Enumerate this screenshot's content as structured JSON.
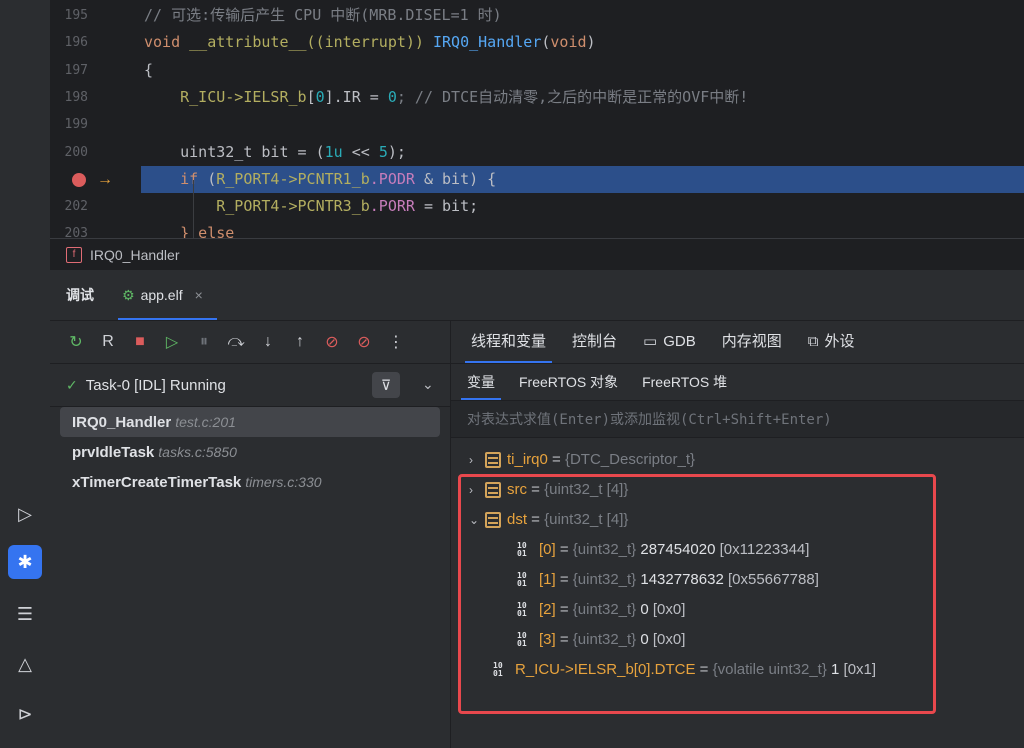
{
  "editor": {
    "lines": [
      {
        "num": "195",
        "parts": [
          {
            "t": "// 可选:传输后产生 CPU 中断(MRB.DISEL=1 时)",
            "c": "cm"
          }
        ]
      },
      {
        "num": "196",
        "parts": [
          {
            "t": "void ",
            "c": "kw"
          },
          {
            "t": "__attribute__((interrupt)) ",
            "c": "mac"
          },
          {
            "t": "IRQ0_Handler",
            "c": "fn"
          },
          {
            "t": "(",
            "c": ""
          },
          {
            "t": "void",
            "c": "kw"
          },
          {
            "t": ")",
            "c": ""
          }
        ]
      },
      {
        "num": "197",
        "parts": [
          {
            "t": "{",
            "c": ""
          }
        ]
      },
      {
        "num": "198",
        "parts": [
          {
            "t": "    R_ICU->IELSR_b",
            "c": "mac"
          },
          {
            "t": "[",
            "c": ""
          },
          {
            "t": "0",
            "c": "num"
          },
          {
            "t": "].IR = ",
            "c": ""
          },
          {
            "t": "0",
            "c": "num"
          },
          {
            "t": "; // DTCE自动清零,之后的中断是正常的OVF中断!",
            "c": "cm"
          }
        ]
      },
      {
        "num": "199",
        "parts": []
      },
      {
        "num": "200",
        "parts": [
          {
            "t": "    uint32_t bit = (",
            "c": ""
          },
          {
            "t": "1u",
            "c": "num"
          },
          {
            "t": " << ",
            "c": ""
          },
          {
            "t": "5",
            "c": "num"
          },
          {
            "t": ");",
            "c": ""
          }
        ]
      },
      {
        "num": "",
        "parts": [
          {
            "t": "    if ",
            "c": "kw"
          },
          {
            "t": "(",
            "c": ""
          },
          {
            "t": "R_PORT4->PCNTR1_b",
            "c": "mac"
          },
          {
            "t": ".PODR",
            "c": "fld"
          },
          {
            "t": " & bit) {",
            "c": ""
          }
        ]
      },
      {
        "num": "202",
        "parts": [
          {
            "t": "        R_PORT4->PCNTR3_b",
            "c": "mac"
          },
          {
            "t": ".PORR",
            "c": "fld"
          },
          {
            "t": " = bit;",
            "c": ""
          }
        ]
      },
      {
        "num": "203",
        "parts": [
          {
            "t": "    } else",
            "c": "kw"
          }
        ]
      }
    ]
  },
  "breadcrumb": {
    "badge": "f",
    "label": "IRQ0_Handler"
  },
  "debug": {
    "title": "调试",
    "session_tab": "app.elf",
    "session_close": "×",
    "toolbar_icons": [
      "rerun-icon",
      "restart-icon",
      "stop-icon",
      "resume-icon",
      "pause-icon",
      "step-over-icon",
      "step-into-icon",
      "step-out-icon",
      "view-breakpoints-icon",
      "mute-breakpoints-icon",
      "more-icon"
    ],
    "thread": {
      "check": "✓",
      "label": "Task-0 [IDL] Running"
    },
    "frames": [
      {
        "name": "IRQ0_Handler",
        "loc": "test.c:201"
      },
      {
        "name": "prvIdleTask",
        "loc": "tasks.c:5850"
      },
      {
        "name": "xTimerCreateTimerTask",
        "loc": "timers.c:330"
      }
    ],
    "tabs": [
      {
        "label": "线程和变量"
      },
      {
        "label": "控制台"
      },
      {
        "label": "GDB",
        "icon": "terminal-icon"
      },
      {
        "label": "内存视图"
      },
      {
        "label": "外设",
        "icon": "chip-icon"
      }
    ],
    "subtabs": [
      "变量",
      "FreeRTOS 对象",
      "FreeRTOS 堆"
    ],
    "eval_placeholder": "对表达式求值(Enter)或添加监视(Ctrl+Shift+Enter)",
    "variables": [
      {
        "name": "ti_irq0",
        "eq": " = ",
        "type": "{DTC_Descriptor_t}",
        "value": "",
        "hex": ""
      },
      {
        "name": "src",
        "eq": " = ",
        "type": "{uint32_t [4]}",
        "value": "",
        "hex": ""
      },
      {
        "name": "dst",
        "eq": " = ",
        "type": "{uint32_t [4]}",
        "value": "",
        "hex": ""
      },
      {
        "name": "[0]",
        "eq": " = ",
        "type": "{uint32_t}",
        "value": " 287454020",
        "hex": " [0x11223344]"
      },
      {
        "name": "[1]",
        "eq": " = ",
        "type": "{uint32_t}",
        "value": " 1432778632",
        "hex": " [0x55667788]"
      },
      {
        "name": "[2]",
        "eq": " = ",
        "type": "{uint32_t}",
        "value": " 0",
        "hex": " [0x0]"
      },
      {
        "name": "[3]",
        "eq": " = ",
        "type": "{uint32_t}",
        "value": " 0",
        "hex": " [0x0]"
      },
      {
        "name": "R_ICU->IELSR_b[0].DTCE",
        "eq": " = ",
        "type": "{volatile uint32_t}",
        "value": " 1",
        "hex": " [0x1]"
      }
    ]
  }
}
